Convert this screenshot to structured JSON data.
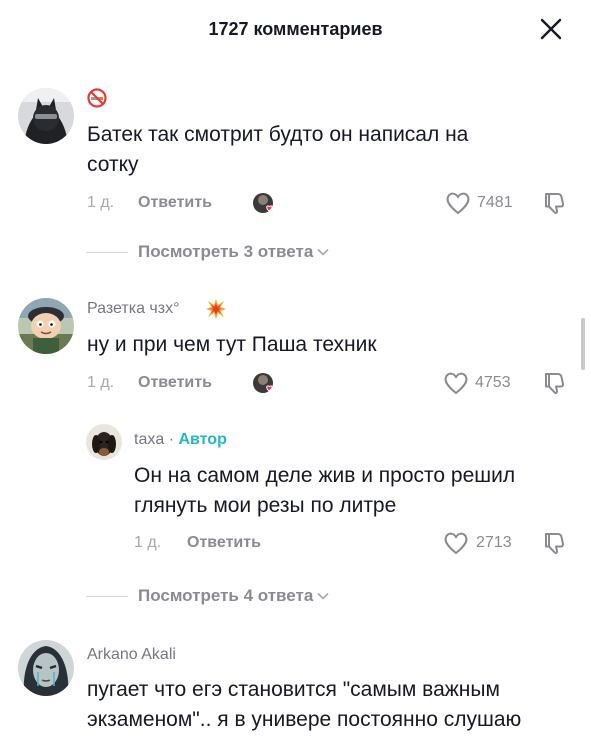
{
  "header": {
    "title": "1727 комментариев"
  },
  "comments": [
    {
      "username": "",
      "text_lines": [
        "Батек так смотрит будто он написал на",
        "сотку"
      ],
      "time": "1 д.",
      "reply_label": "Ответить",
      "likes": "7481",
      "icons": {
        "avatar": "dark-cat-avatar",
        "name_badge": "no-smoking-icon"
      }
    },
    {
      "username": "Разетка чзх°",
      "text_lines": [
        "ну и при чем тут Паша техник"
      ],
      "time": "1 д.",
      "reply_label": "Ответить",
      "likes": "4753",
      "icons": {
        "avatar": "cartoon-character-avatar",
        "name_badge": "collision-icon"
      }
    },
    {
      "username": "Arkano Akali",
      "text_lines": [
        "пугает что егэ становится \"самым важным",
        "экзаменом\".. я в универе постоянно слушаю"
      ],
      "icons": {
        "avatar": "painted-face-avatar"
      }
    }
  ],
  "reply": {
    "username": "taxa",
    "separator": "·",
    "author_label": "Автор",
    "text_lines": [
      "Он на самом деле жив и просто решил",
      "глянуть мои резы по литре"
    ],
    "time": "1 д.",
    "reply_label": "Ответить",
    "likes": "2713",
    "icons": {
      "avatar": "dachshund-avatar"
    }
  },
  "view_replies": [
    {
      "label": "Посмотреть 3 ответа"
    },
    {
      "label": "Посмотреть 4 ответа"
    }
  ],
  "colors": {
    "author": "#22b8c9",
    "liked_heart": "#fe2c55",
    "muted": "#8a8b91"
  }
}
